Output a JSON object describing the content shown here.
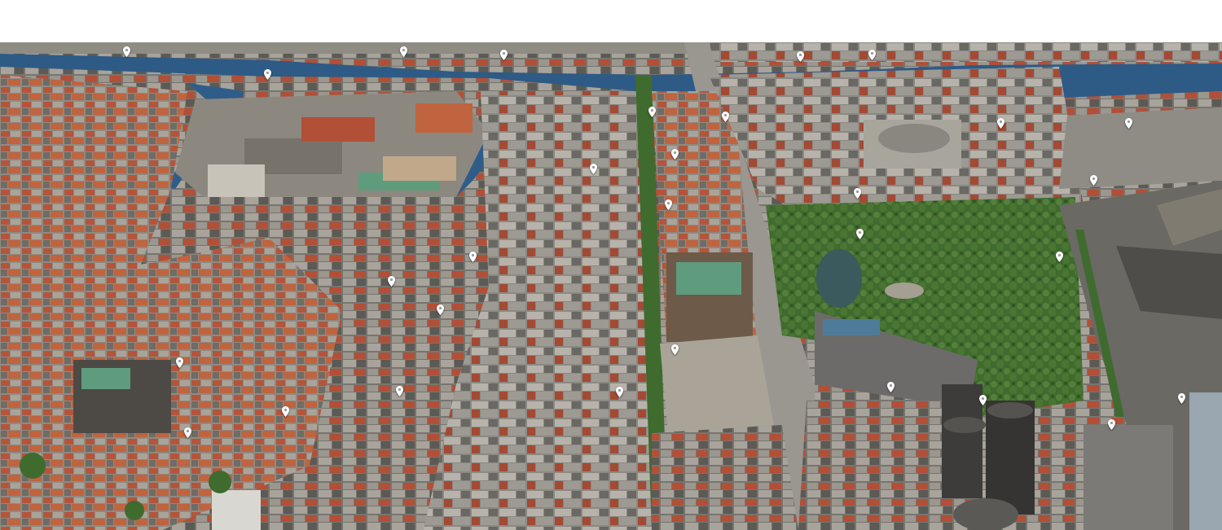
{
  "scene": {
    "kind": "oblique aerial photograph of a city center with a harbour",
    "colors": {
      "water": "#2e5a86",
      "roof_red": "#b5533a",
      "roof_grey": "#8a8a86",
      "roof_copper": "#5f9c7e",
      "park": "#3f6b2e",
      "road": "#9a9690",
      "pin": "#ffffff"
    },
    "pin_icon": "map-pin-icon",
    "pin_count": 30
  }
}
